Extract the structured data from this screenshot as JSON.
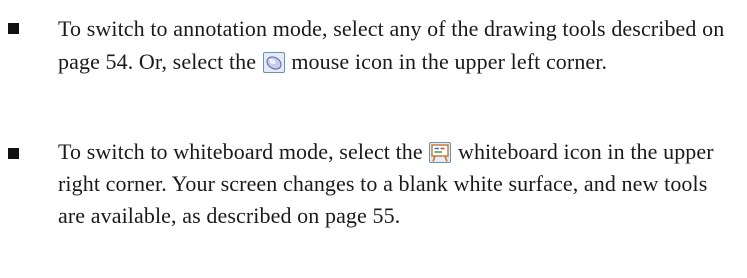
{
  "bullets": [
    {
      "text_before_icon": "To switch to annotation mode, select any of the drawing tools described on page 54. Or, select the ",
      "icon": "mouse-icon",
      "text_after_icon": " mouse icon in the upper left corner."
    },
    {
      "text_before_icon": "To switch to whiteboard mode, select the ",
      "icon": "whiteboard-icon",
      "text_after_icon": " whiteboard icon in the upper right corner. Your screen changes to a blank white surface, and new tools are available, as described on page 55."
    }
  ],
  "colors": {
    "text": "#1a1a1a",
    "bullet": "#111111",
    "icon_border": "#6f8fb3",
    "icon_bg": "#e4edf7",
    "whiteboard_easel": "#c8742c"
  }
}
